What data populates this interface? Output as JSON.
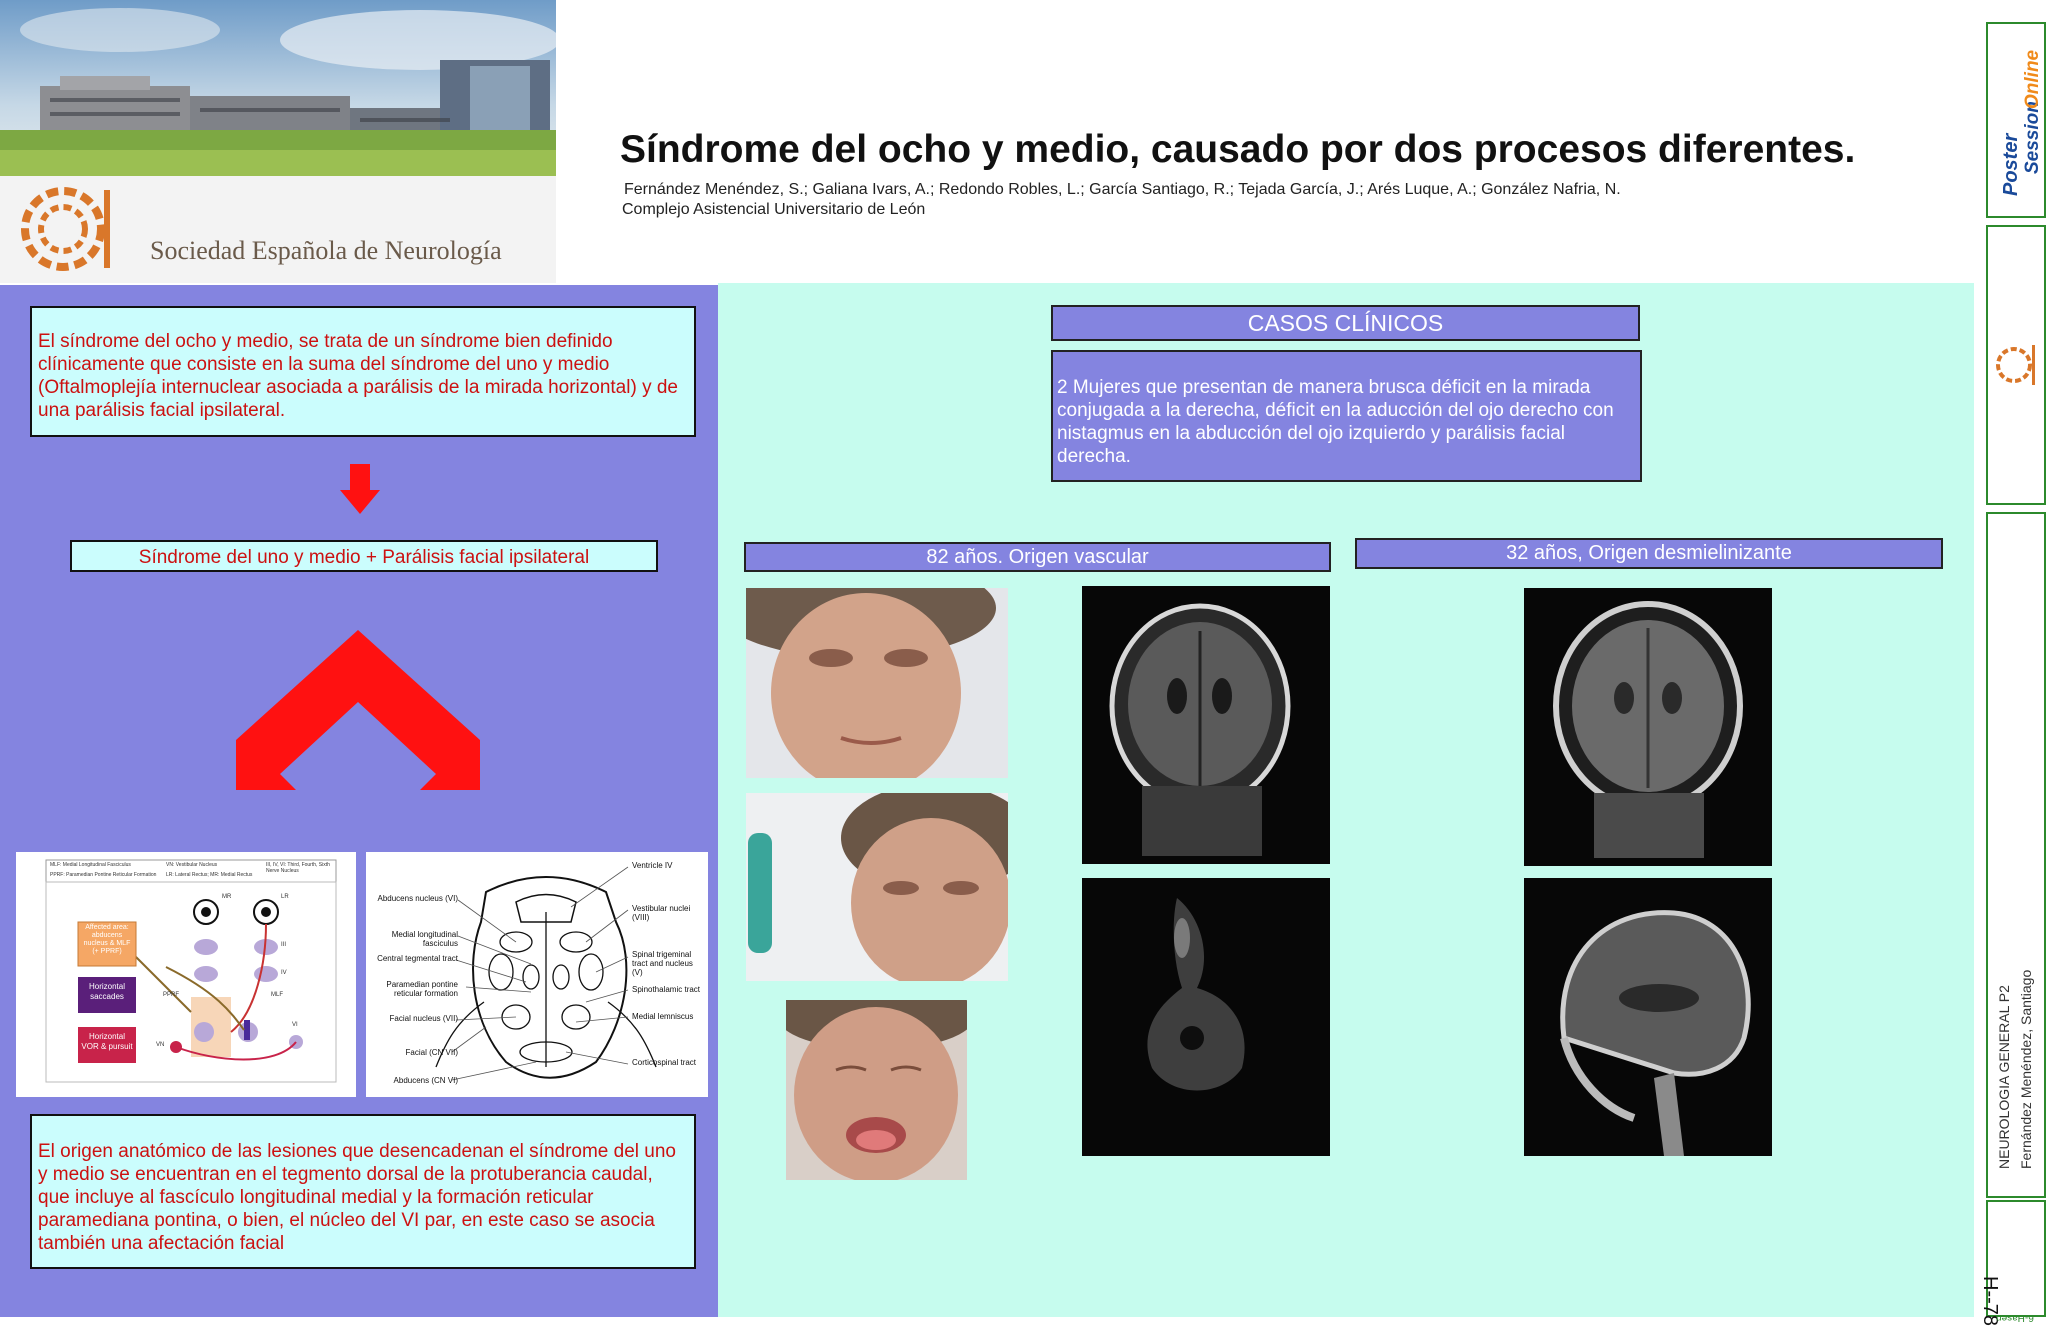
{
  "header": {
    "title": "Síndrome del ocho y medio, causado por dos procesos diferentes.",
    "authors": "Fernández Menéndez, S.; Galiana Ivars, A.; Redondo Robles, L.; García Santiago, R.; Tejada García, J.; Arés Luque, A.; González Nafria, N.",
    "institution": "Complejo Asistencial Universitario de León",
    "society_name": "Sociedad Española de Neurología"
  },
  "left": {
    "intro": "El síndrome del ocho y medio, se trata de un síndrome bien definido clínicamente que  consiste en la suma del síndrome del uno y medio (Oftalmoplejía internuclear asociada a parálisis de la mirada horizontal) y de una parálisis facial ipsilateral.",
    "formula": "Síndrome del uno y medio + Parálisis facial ipsilateral",
    "origin": "El origen anatómico de las lesiones que desencadenan el síndrome del uno y medio se encuentran en el tegmento dorsal de la protuberancia caudal, que incluye al fascículo longitudinal medial y la formación reticular paramediana pontina, o bien, el núcleo del VI par, en este caso se asocia también una afectación facial"
  },
  "diagram1": {
    "legend_1": "MLF: Medial Longitudinal Fasciculus",
    "legend_2": "VN: Vestibular Nucleus",
    "legend_3": "III, IV, VI: Third, Fourth, Sixth Nerve Nucleus",
    "legend_4": "PPRF: Paramedian Pontine Reticular Formation",
    "legend_5": "LR: Lateral Rectus; MR: Medial Rectus",
    "box_affected": "Affected area: abducens nucleus & MLF (+ PPRF)",
    "box_saccades": "Horizontal saccades",
    "box_vor": "Horizontal VOR & pursuit",
    "lbl_mr": "MR",
    "lbl_lr": "LR",
    "lbl_iii": "III",
    "lbl_iv": "IV",
    "lbl_mlf": "MLF",
    "lbl_pprf": "PPRF",
    "lbl_vi": "VI",
    "lbl_vn": "VN"
  },
  "diagram2": {
    "labels_left": [
      "Abducens nucleus (VI)",
      "Medial longitudinal fasciculus",
      "Central tegmental tract",
      "Paramedian pontine reticular formation",
      "Facial nucleus (VII)",
      "Facial (CN VII)",
      "Abducens (CN VI)"
    ],
    "labels_right": [
      "Ventricle IV",
      "Vestibular nuclei (VIII)",
      "Spinal trigeminal tract and nucleus (V)",
      "Spinothalamic tract",
      "Medial lemniscus",
      "Corticospinal tract"
    ]
  },
  "right": {
    "casos_title": "CASOS CLÍNICOS",
    "casos_text": "2 Mujeres que presentan de manera brusca déficit en la mirada conjugada a la derecha, déficit en la aducción del ojo derecho con nistagmus en la abducción del ojo izquierdo y parálisis facial derecha.",
    "case1_label": "82 años. Origen vascular",
    "case2_label": "32 años, Origen desmielinizante"
  },
  "sidebar": {
    "brand_poster": "Poster",
    "brand_session": "Session",
    "brand_online": "Online",
    "area": "NEUROLOGIA GENERAL P2",
    "author": "Fernández Menéndez, Santiago",
    "code": "H--78",
    "footer": "6-Hasen"
  },
  "colors": {
    "left_bg": "#8484e0",
    "right_bg": "#c6fcee",
    "text_red": "#cc1111",
    "arrow_red": "#ff1111",
    "sidebar_green": "#2c8a2c"
  }
}
